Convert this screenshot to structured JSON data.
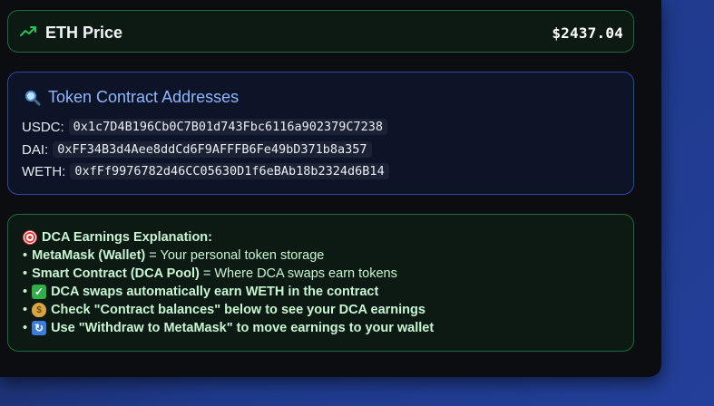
{
  "eth_price": {
    "label": "ETH Price",
    "value": "$2437.04",
    "icon": "trending-up-icon",
    "accent": "#22c55e"
  },
  "addresses": {
    "title": "Token Contract Addresses",
    "icon": "magnifier-icon",
    "rows": [
      {
        "label": "USDC:",
        "address": "0x1c7D4B196Cb0C7B01d743Fbc6116a902379C7238"
      },
      {
        "label": "DAI:",
        "address": "0xFF34B3d4Aee8ddCd6F9AFFFB6Fe49bD371b8a357"
      },
      {
        "label": "WETH:",
        "address": "0xfFf9976782d46CC05630D1f6eBAb18b2324d6B14"
      }
    ]
  },
  "dca": {
    "title": "DCA Earnings Explanation:",
    "title_icon": "target-icon",
    "bullet": "•",
    "lines": [
      {
        "bold": "MetaMask (Wallet)",
        "text": " = Your personal token storage"
      },
      {
        "bold": "Smart Contract (DCA Pool)",
        "text": " = Where DCA swaps earn tokens"
      },
      {
        "icon": "check-icon",
        "bold": "DCA swaps automatically earn WETH in the contract"
      },
      {
        "icon": "money-bag-icon",
        "bold": "Check \"Contract balances\" below to see your DCA earnings"
      },
      {
        "icon": "refresh-icon",
        "bold": "Use \"Withdraw to MetaMask\" to move earnings to your wallet"
      }
    ]
  }
}
